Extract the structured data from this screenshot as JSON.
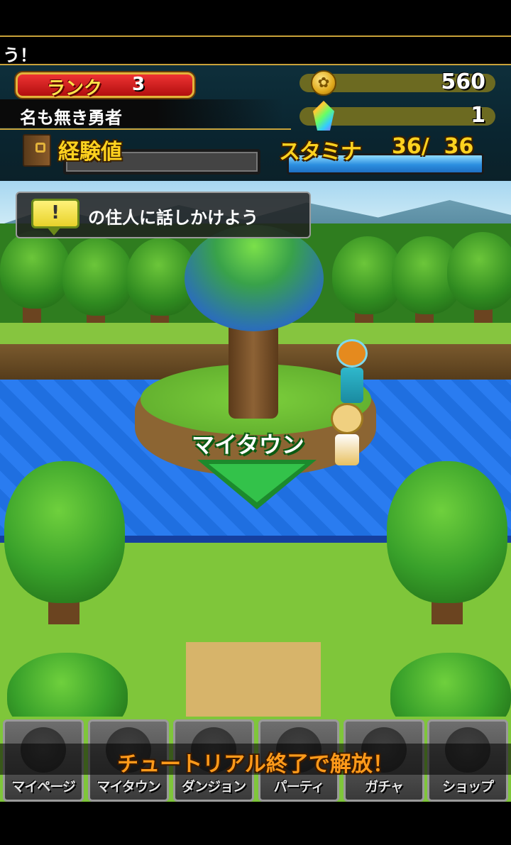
{
  "ticker": {
    "text": "う！"
  },
  "player": {
    "rank_label": "ランク",
    "rank_value": "3",
    "name": "名も無き勇者",
    "exp_label": "経験値",
    "stamina_label": "スタミナ",
    "stamina_text": "36/  36",
    "stamina_current": 36,
    "stamina_max": 36
  },
  "currency": {
    "coins": "560",
    "gems": "1",
    "coin_icon": "gold-coin-icon",
    "gem_icon": "rainbow-gem-icon"
  },
  "quest": {
    "icon_mark": "!",
    "text": "の住人に話しかけよう"
  },
  "map": {
    "mytown_label": "マイタウン"
  },
  "nav": {
    "locked_message": "チュートリアル終了で解放！",
    "items": [
      {
        "label": "マイページ",
        "icon": "magic-circle-icon"
      },
      {
        "label": "マイタウン",
        "icon": "town-icon"
      },
      {
        "label": "ダンジョン",
        "icon": "treasure-chest-icon"
      },
      {
        "label": "パーティ",
        "icon": "weapons-icon"
      },
      {
        "label": "ガチャ",
        "icon": "potion-icon"
      },
      {
        "label": "ショップ",
        "icon": "ore-icon"
      }
    ]
  },
  "colors": {
    "rank_plate": "#d62020",
    "stamina_fill": "#2c8fe0",
    "locked_text": "#ff9a1a"
  }
}
